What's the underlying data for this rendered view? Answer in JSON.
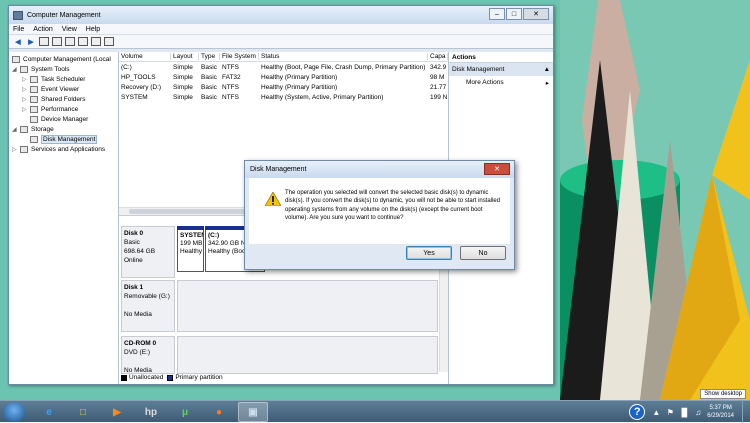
{
  "window": {
    "title": "Computer Management",
    "minimize": "–",
    "maximize": "□",
    "close": "✕"
  },
  "menu": [
    "File",
    "Action",
    "View",
    "Help"
  ],
  "tree": [
    {
      "label": "Computer Management (Local",
      "level": 0,
      "exp": ""
    },
    {
      "label": "System Tools",
      "level": 1,
      "exp": "◢"
    },
    {
      "label": "Task Scheduler",
      "level": 2,
      "exp": "▷"
    },
    {
      "label": "Event Viewer",
      "level": 2,
      "exp": "▷"
    },
    {
      "label": "Shared Folders",
      "level": 2,
      "exp": "▷"
    },
    {
      "label": "Performance",
      "level": 2,
      "exp": "▷"
    },
    {
      "label": "Device Manager",
      "level": 2,
      "exp": ""
    },
    {
      "label": "Storage",
      "level": 1,
      "exp": "◢"
    },
    {
      "label": "Disk Management",
      "level": 2,
      "exp": "",
      "selected": true
    },
    {
      "label": "Services and Applications",
      "level": 1,
      "exp": "▷"
    }
  ],
  "volume_table": {
    "headers": [
      "Volume",
      "Layout",
      "Type",
      "File System",
      "Status",
      "Capa"
    ],
    "rows": [
      [
        "(C:)",
        "Simple",
        "Basic",
        "NTFS",
        "Healthy (Boot, Page File, Crash Dump, Primary Partition)",
        "342.9"
      ],
      [
        "HP_TOOLS",
        "Simple",
        "Basic",
        "FAT32",
        "Healthy (Primary Partition)",
        "98 M"
      ],
      [
        "Recovery (D:)",
        "Simple",
        "Basic",
        "NTFS",
        "Healthy (Primary Partition)",
        "21.77"
      ],
      [
        "SYSTEM",
        "Simple",
        "Basic",
        "NTFS",
        "Healthy (System, Active, Primary Partition)",
        "199 N"
      ]
    ]
  },
  "disks": {
    "disk0": {
      "name": "Disk 0",
      "type": "Basic",
      "size": "698.64 GB",
      "status": "Online",
      "partitions": [
        {
          "name": "SYSTEM",
          "size": "199 MB",
          "status": "Healthy"
        },
        {
          "name": "(C:)",
          "size": "342.90 GB NTFS",
          "status": "Healthy (Boo"
        }
      ]
    },
    "disk1": {
      "name": "Disk 1",
      "type": "Removable (G:)",
      "media": "No Media"
    },
    "cdrom0": {
      "name": "CD-ROM 0",
      "type": "DVD (E:)",
      "media": "No Media"
    }
  },
  "legend": {
    "unallocated": "Unallocated",
    "primary": "Primary partition"
  },
  "actions": {
    "header": "Actions",
    "section": "Disk Management",
    "more": "More Actions"
  },
  "dialog": {
    "title": "Disk Management",
    "close": "✕",
    "message": "The operation you selected will convert the selected basic disk(s) to dynamic disk(s). If you convert the disk(s) to dynamic, you will not be able to start installed operating systems from any volume on the disk(s) (except the current boot volume). Are you sure you want to continue?",
    "yes": "Yes",
    "no": "No"
  },
  "taskbar": {
    "time": "5:37 PM",
    "date": "6/29/2014",
    "tooltip": "Show desktop",
    "pinned": [
      "internet-explorer",
      "windows-explorer",
      "media-player",
      "hp-app",
      "utorrent",
      "firefox",
      "computer-management"
    ]
  },
  "colors": {
    "primary_partition": "#1a2e8f",
    "desktop": "#6bc4b0",
    "dialog_close": "#c94e3d"
  }
}
